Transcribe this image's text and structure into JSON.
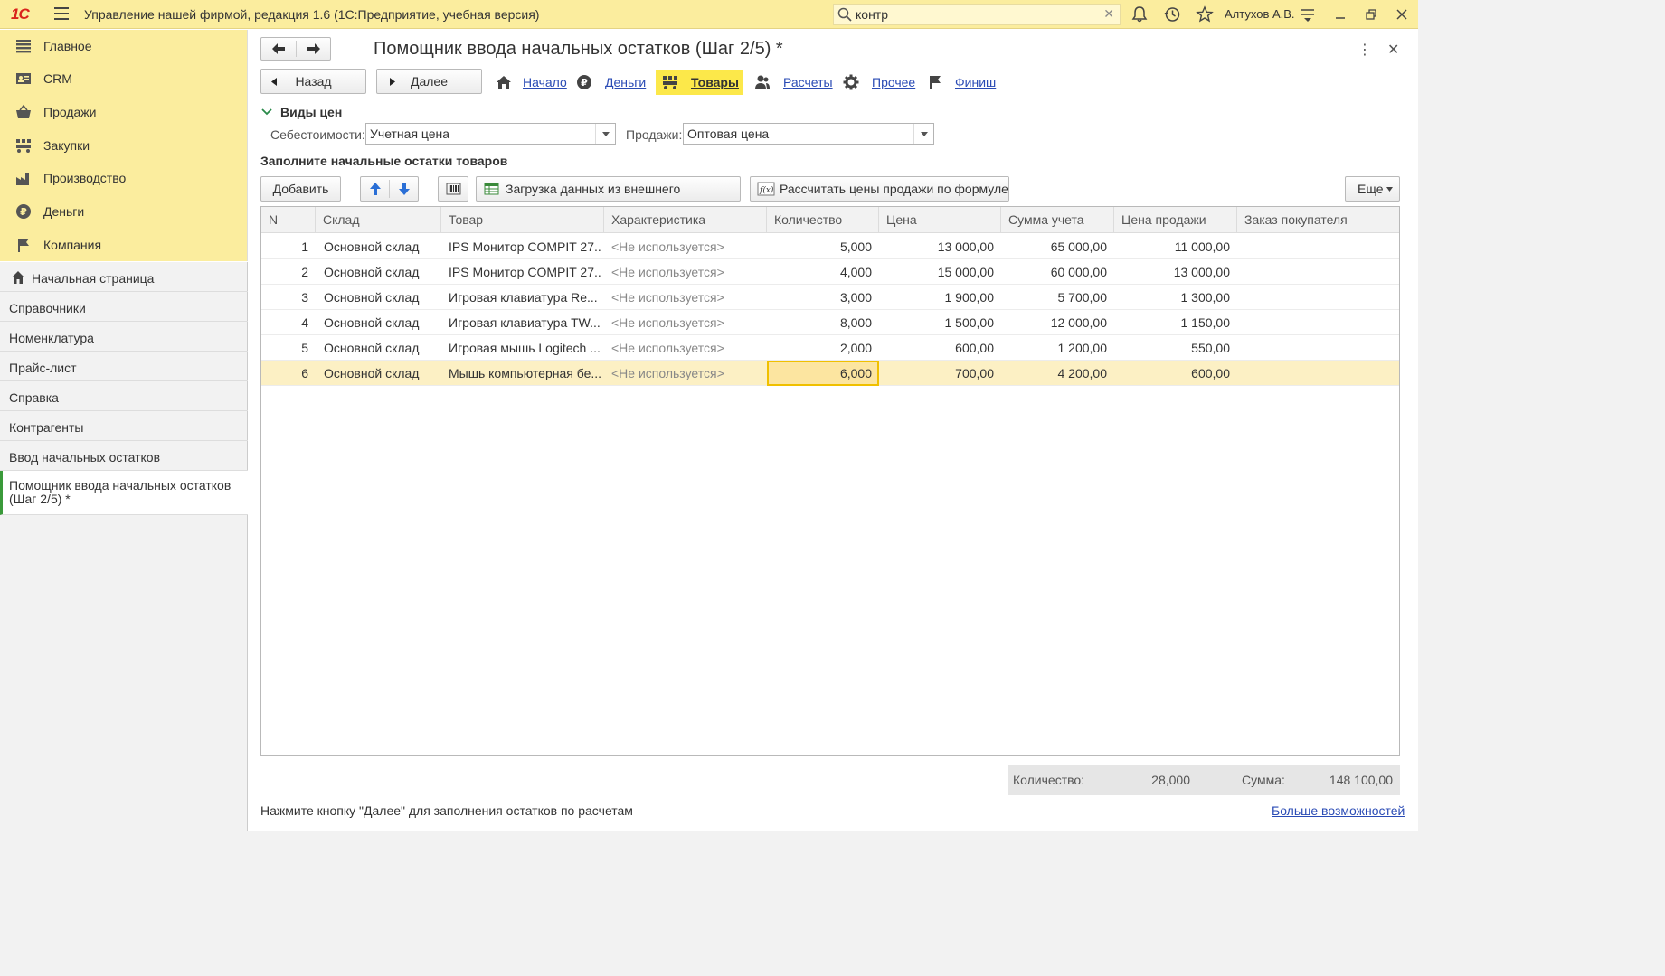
{
  "app": {
    "logo": "1С",
    "title": "Управление нашей фирмой, редакция 1.6  (1С:Предприятие, учебная версия)",
    "search_value": "контр",
    "user": "Алтухов А.В."
  },
  "sections": [
    {
      "label": "Главное",
      "icon": "list-icon"
    },
    {
      "label": "CRM",
      "icon": "crm-icon"
    },
    {
      "label": "Продажи",
      "icon": "basket-icon"
    },
    {
      "label": "Закупки",
      "icon": "purchases-icon"
    },
    {
      "label": "Производство",
      "icon": "factory-icon"
    },
    {
      "label": "Деньги",
      "icon": "ruble-icon"
    },
    {
      "label": "Компания",
      "icon": "flag-icon"
    }
  ],
  "open_windows": [
    {
      "label": "Начальная страница",
      "icon": "home-icon"
    },
    {
      "label": "Справочники"
    },
    {
      "label": "Номенклатура"
    },
    {
      "label": "Прайс-лист"
    },
    {
      "label": "Справка"
    },
    {
      "label": "Контрагенты"
    },
    {
      "label": "Ввод начальных остатков"
    },
    {
      "label": "Помощник ввода начальных остатков (Шаг 2/5) *",
      "active": true
    }
  ],
  "form": {
    "title": "Помощник ввода начальных остатков (Шаг 2/5) *",
    "back_label": "Назад",
    "next_label": "Далее",
    "steps": [
      {
        "label": "Начало",
        "icon": "home-icon"
      },
      {
        "label": "Деньги",
        "icon": "ruble-icon"
      },
      {
        "label": "Товары",
        "icon": "goods-icon",
        "active": true
      },
      {
        "label": "Расчеты",
        "icon": "people-icon"
      },
      {
        "label": "Прочее",
        "icon": "gear-icon"
      },
      {
        "label": "Финиш",
        "icon": "flag-icon"
      }
    ],
    "price_group_title": "Виды цен",
    "cost_label": "Себестоимости:",
    "cost_value": "Учетная цена",
    "sales_label": "Продажи:",
    "sales_value": "Оптовая цена",
    "goods_title": "Заполните начальные остатки товаров",
    "add_label": "Добавить",
    "load_label": "Загрузка данных из внешнего источника",
    "calc_label": "Рассчитать цены продажи по формуле",
    "more_label": "Еще",
    "accent": "#fce84a"
  },
  "table": {
    "columns": [
      "N",
      "Склад",
      "Товар",
      "Характеристика",
      "Количество",
      "Цена",
      "Сумма учета",
      "Цена продажи",
      "Заказ покупателя"
    ],
    "rows": [
      {
        "n": "1",
        "warehouse": "Основной склад",
        "product": "IPS Монитор COMPIT 27...",
        "feature": "<Не используется>",
        "qty": "5,000",
        "price": "13 000,00",
        "sum": "65 000,00",
        "sale": "11 000,00",
        "order": ""
      },
      {
        "n": "2",
        "warehouse": "Основной склад",
        "product": "IPS Монитор COMPIT 27...",
        "feature": "<Не используется>",
        "qty": "4,000",
        "price": "15 000,00",
        "sum": "60 000,00",
        "sale": "13 000,00",
        "order": ""
      },
      {
        "n": "3",
        "warehouse": "Основной склад",
        "product": "Игровая клавиатура Re...",
        "feature": "<Не используется>",
        "qty": "3,000",
        "price": "1 900,00",
        "sum": "5 700,00",
        "sale": "1 300,00",
        "order": ""
      },
      {
        "n": "4",
        "warehouse": "Основной склад",
        "product": "Игровая клавиатура TW...",
        "feature": "<Не используется>",
        "qty": "8,000",
        "price": "1 500,00",
        "sum": "12 000,00",
        "sale": "1 150,00",
        "order": ""
      },
      {
        "n": "5",
        "warehouse": "Основной склад",
        "product": "Игровая мышь Logitech ...",
        "feature": "<Не используется>",
        "qty": "2,000",
        "price": "600,00",
        "sum": "1 200,00",
        "sale": "550,00",
        "order": ""
      },
      {
        "n": "6",
        "warehouse": "Основной склад",
        "product": "Мышь компьютерная бе...",
        "feature": "<Не используется>",
        "qty": "6,000",
        "price": "700,00",
        "sum": "4 200,00",
        "sale": "600,00",
        "order": "",
        "selected": true
      }
    ]
  },
  "totals": {
    "qty_label": "Количество:",
    "qty_value": "28,000",
    "sum_label": "Сумма:",
    "sum_value": "148 100,00"
  },
  "footer": {
    "hint": "Нажмите кнопку \"Далее\" для заполнения остатков по расчетам",
    "more_link": "Больше возможностей"
  }
}
